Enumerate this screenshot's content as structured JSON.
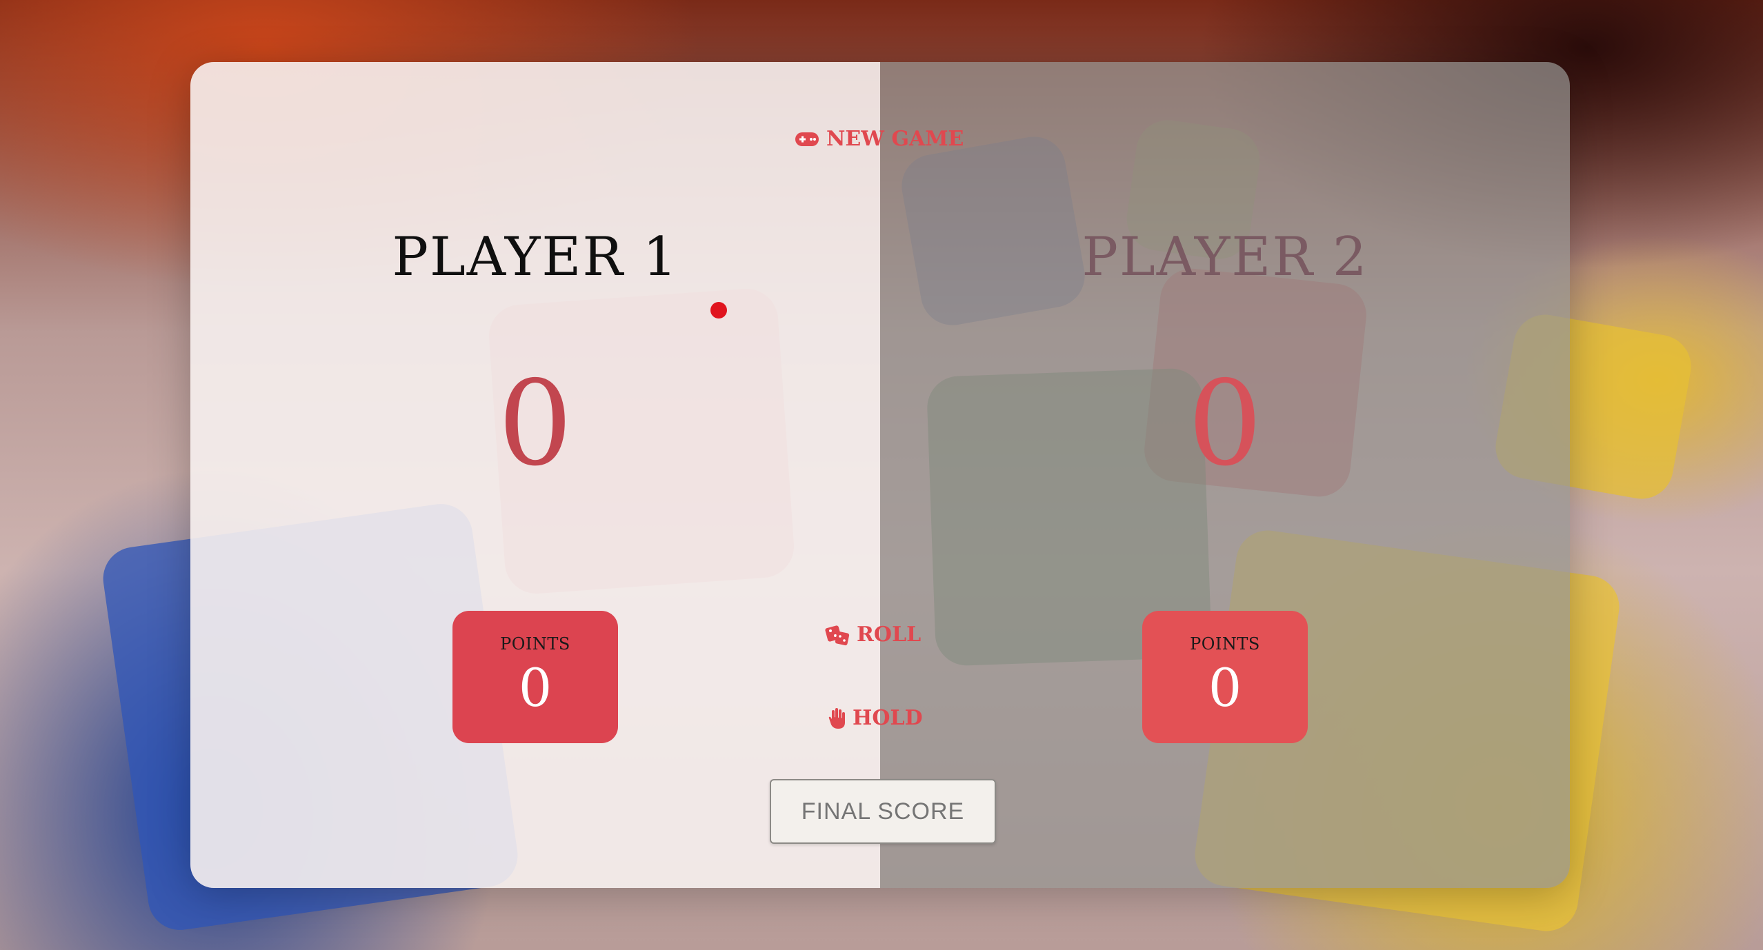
{
  "game": {
    "new_game_label": "NEW GAME",
    "roll_label": "ROLL",
    "hold_label": "HOLD",
    "final_score_placeholder": "FINAL SCORE",
    "active_player": 1,
    "accent_color": "#e0484f"
  },
  "players": [
    {
      "name": "PLAYER 1",
      "score": "0",
      "points_label": "POINTS",
      "points": "0"
    },
    {
      "name": "PLAYER 2",
      "score": "0",
      "points_label": "POINTS",
      "points": "0"
    }
  ],
  "icons": {
    "new_game": "gamepad-icon",
    "roll": "dice-icon",
    "hold": "hand-icon"
  }
}
